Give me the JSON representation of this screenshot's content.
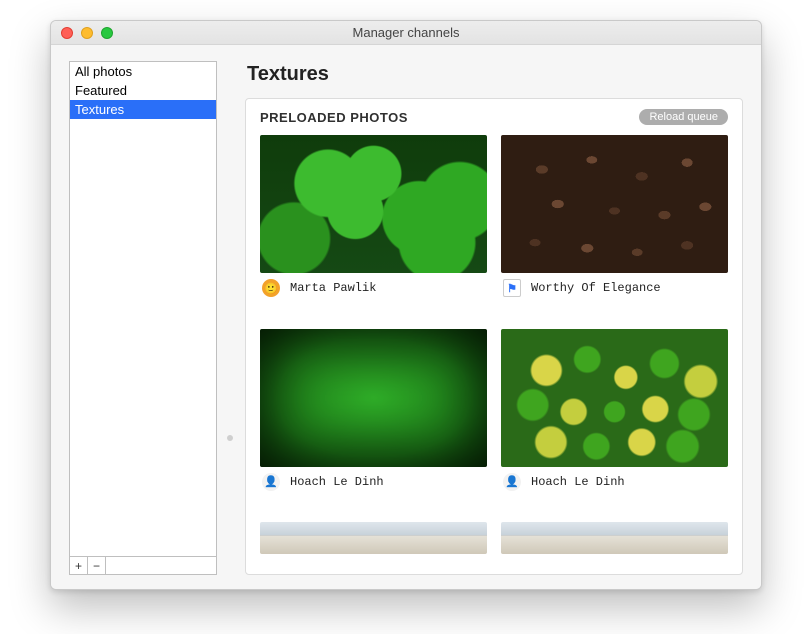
{
  "window": {
    "title": "Manager channels"
  },
  "sidebar": {
    "items": [
      {
        "label": "All photos",
        "selected": false
      },
      {
        "label": "Featured",
        "selected": false
      },
      {
        "label": "Textures",
        "selected": true
      }
    ],
    "add_label": "+",
    "remove_label": "−"
  },
  "main": {
    "title": "Textures",
    "section_title": "PRELOADED PHOTOS",
    "reload_label": "Reload queue",
    "photos": [
      {
        "author": "Marta Pawlik",
        "avatar_kind": "orange",
        "thumb_kind": "clover"
      },
      {
        "author": "Worthy Of Elegance",
        "avatar_kind": "flag",
        "thumb_kind": "beans"
      },
      {
        "author": "Hoach Le Dinh",
        "avatar_kind": "white",
        "thumb_kind": "hedge"
      },
      {
        "author": "Hoach Le Dinh",
        "avatar_kind": "white",
        "thumb_kind": "peas"
      },
      {
        "author": "",
        "avatar_kind": "",
        "thumb_kind": "buildings"
      },
      {
        "author": "",
        "avatar_kind": "",
        "thumb_kind": "buildings"
      }
    ]
  }
}
